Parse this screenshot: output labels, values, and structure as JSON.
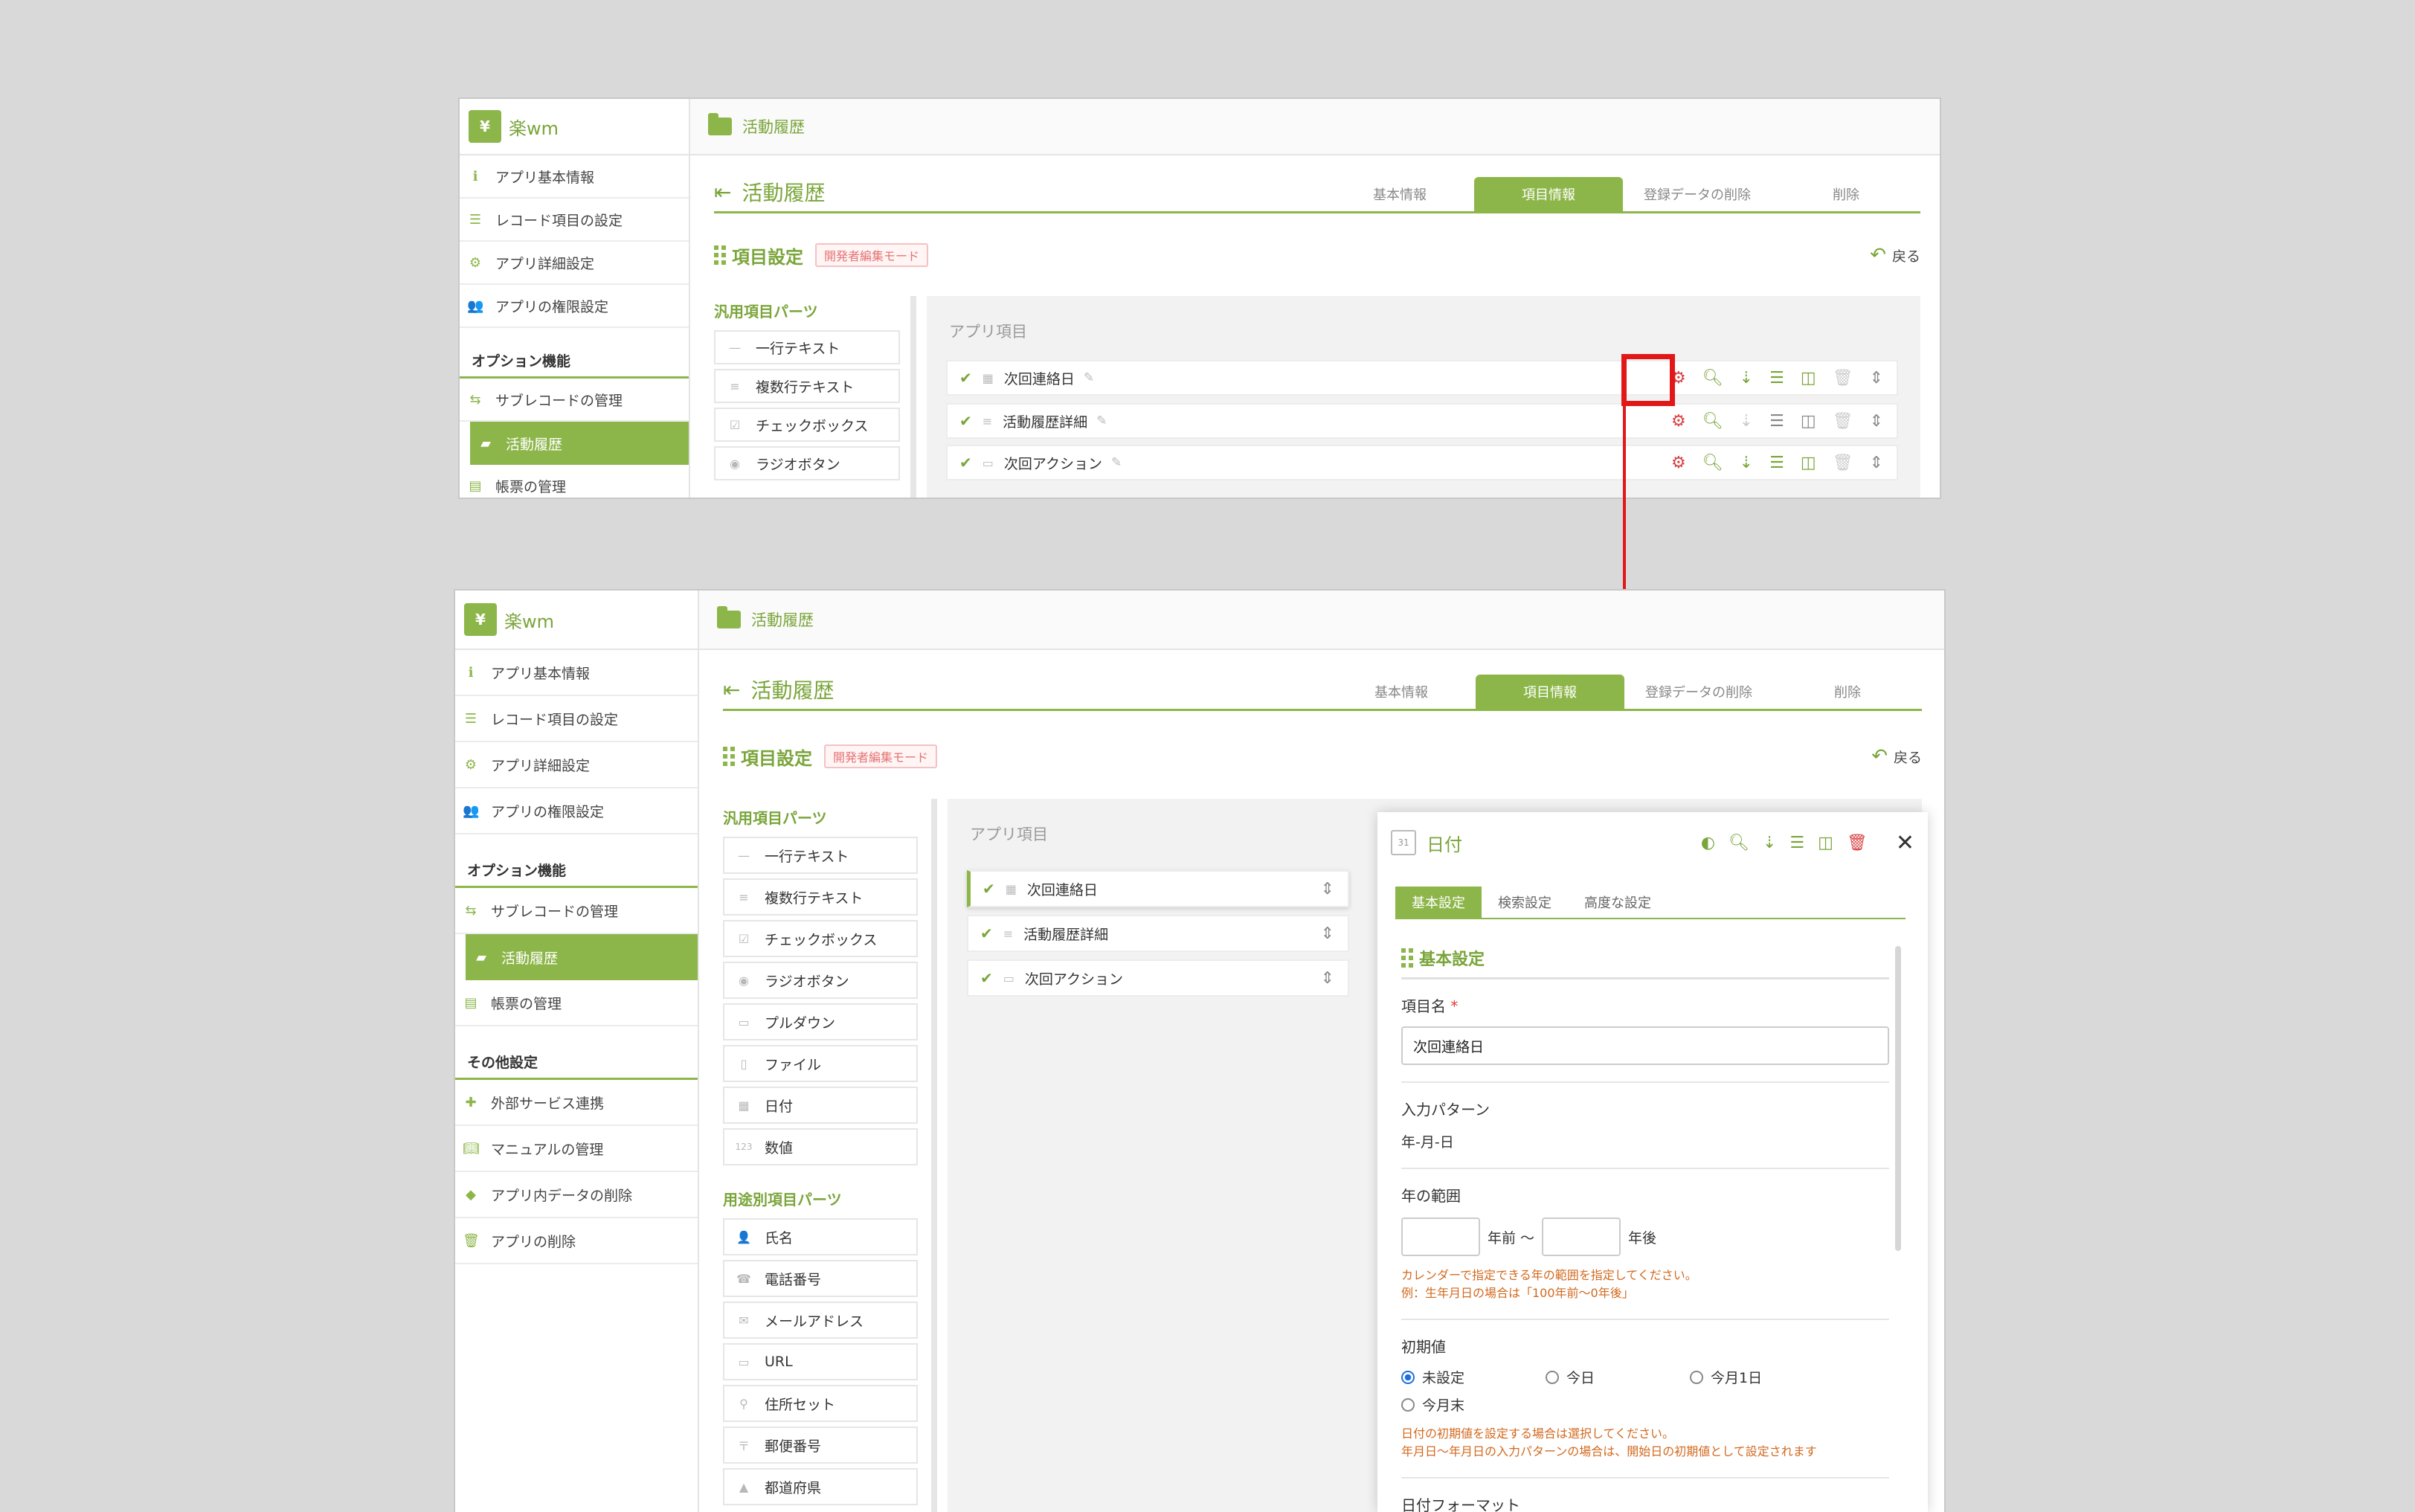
{
  "app": {
    "logo_text": "楽wm"
  },
  "sidebar": {
    "items": [
      {
        "label": "アプリ基本情報"
      },
      {
        "label": "レコード項目の設定"
      },
      {
        "label": "アプリ詳細設定"
      },
      {
        "label": "アプリの権限設定"
      }
    ],
    "option_heading": "オプション機能",
    "option_items": [
      {
        "label": "サブレコードの管理"
      },
      {
        "label": "活動履歴"
      },
      {
        "label": "帳票の管理"
      }
    ],
    "other_heading": "その他設定",
    "other_items": [
      {
        "label": "外部サービス連携"
      },
      {
        "label": "マニュアルの管理"
      },
      {
        "label": "アプリ内データの削除"
      },
      {
        "label": "アプリの削除"
      }
    ]
  },
  "header": {
    "breadcrumb": "活動履歴"
  },
  "page": {
    "title": "活動履歴",
    "tabs": [
      "基本情報",
      "項目情報",
      "登録データの削除",
      "削除"
    ],
    "section_title": "項目設定",
    "mode_badge": "開発者編集モード",
    "back_label": "戻る"
  },
  "parts": {
    "general_title": "汎用項目パーツ",
    "general": [
      "一行テキスト",
      "複数行テキスト",
      "チェックボックス",
      "ラジオボタン",
      "プルダウン",
      "ファイル",
      "日付",
      "数値"
    ],
    "general_icons": [
      "—",
      "≡",
      "☑",
      "◉",
      "▭",
      "▯",
      "▦",
      "123"
    ],
    "purpose_title": "用途別項目パーツ",
    "purpose": [
      "氏名",
      "電話番号",
      "メールアドレス",
      "URL",
      "住所セット",
      "郵便番号",
      "都道府県"
    ],
    "purpose_icons": [
      "👤",
      "☎",
      "✉",
      "▭",
      "⚲",
      "〒",
      "▲"
    ]
  },
  "app_items": {
    "title": "アプリ項目",
    "rows": [
      "次回連絡日",
      "活動履歴詳細",
      "次回アクション"
    ]
  },
  "panel": {
    "title": "日付",
    "cal_icon_text": "31",
    "tabs": [
      "基本設定",
      "検索設定",
      "高度な設定"
    ],
    "section": "基本設定",
    "name_label": "項目名",
    "required_mark": "*",
    "name_value": "次回連絡日",
    "pattern_label": "入力パターン",
    "pattern_value": "年-月-日",
    "range_label": "年の範囲",
    "range_before": "年前 〜",
    "range_after": "年後",
    "range_note1": "カレンダーで指定できる年の範囲を指定してください。",
    "range_note2": "例：生年月日の場合は「100年前〜0年後」",
    "initial_label": "初期値",
    "radio_options": [
      "未設定",
      "今日",
      "今月1日",
      "今月末"
    ],
    "initial_note1": "日付の初期値を設定する場合は選択してください。",
    "initial_note2": "年月日〜年月日の入力パターンの場合は、開始日の初期値として設定されます",
    "format_label": "日付フォーマット"
  }
}
